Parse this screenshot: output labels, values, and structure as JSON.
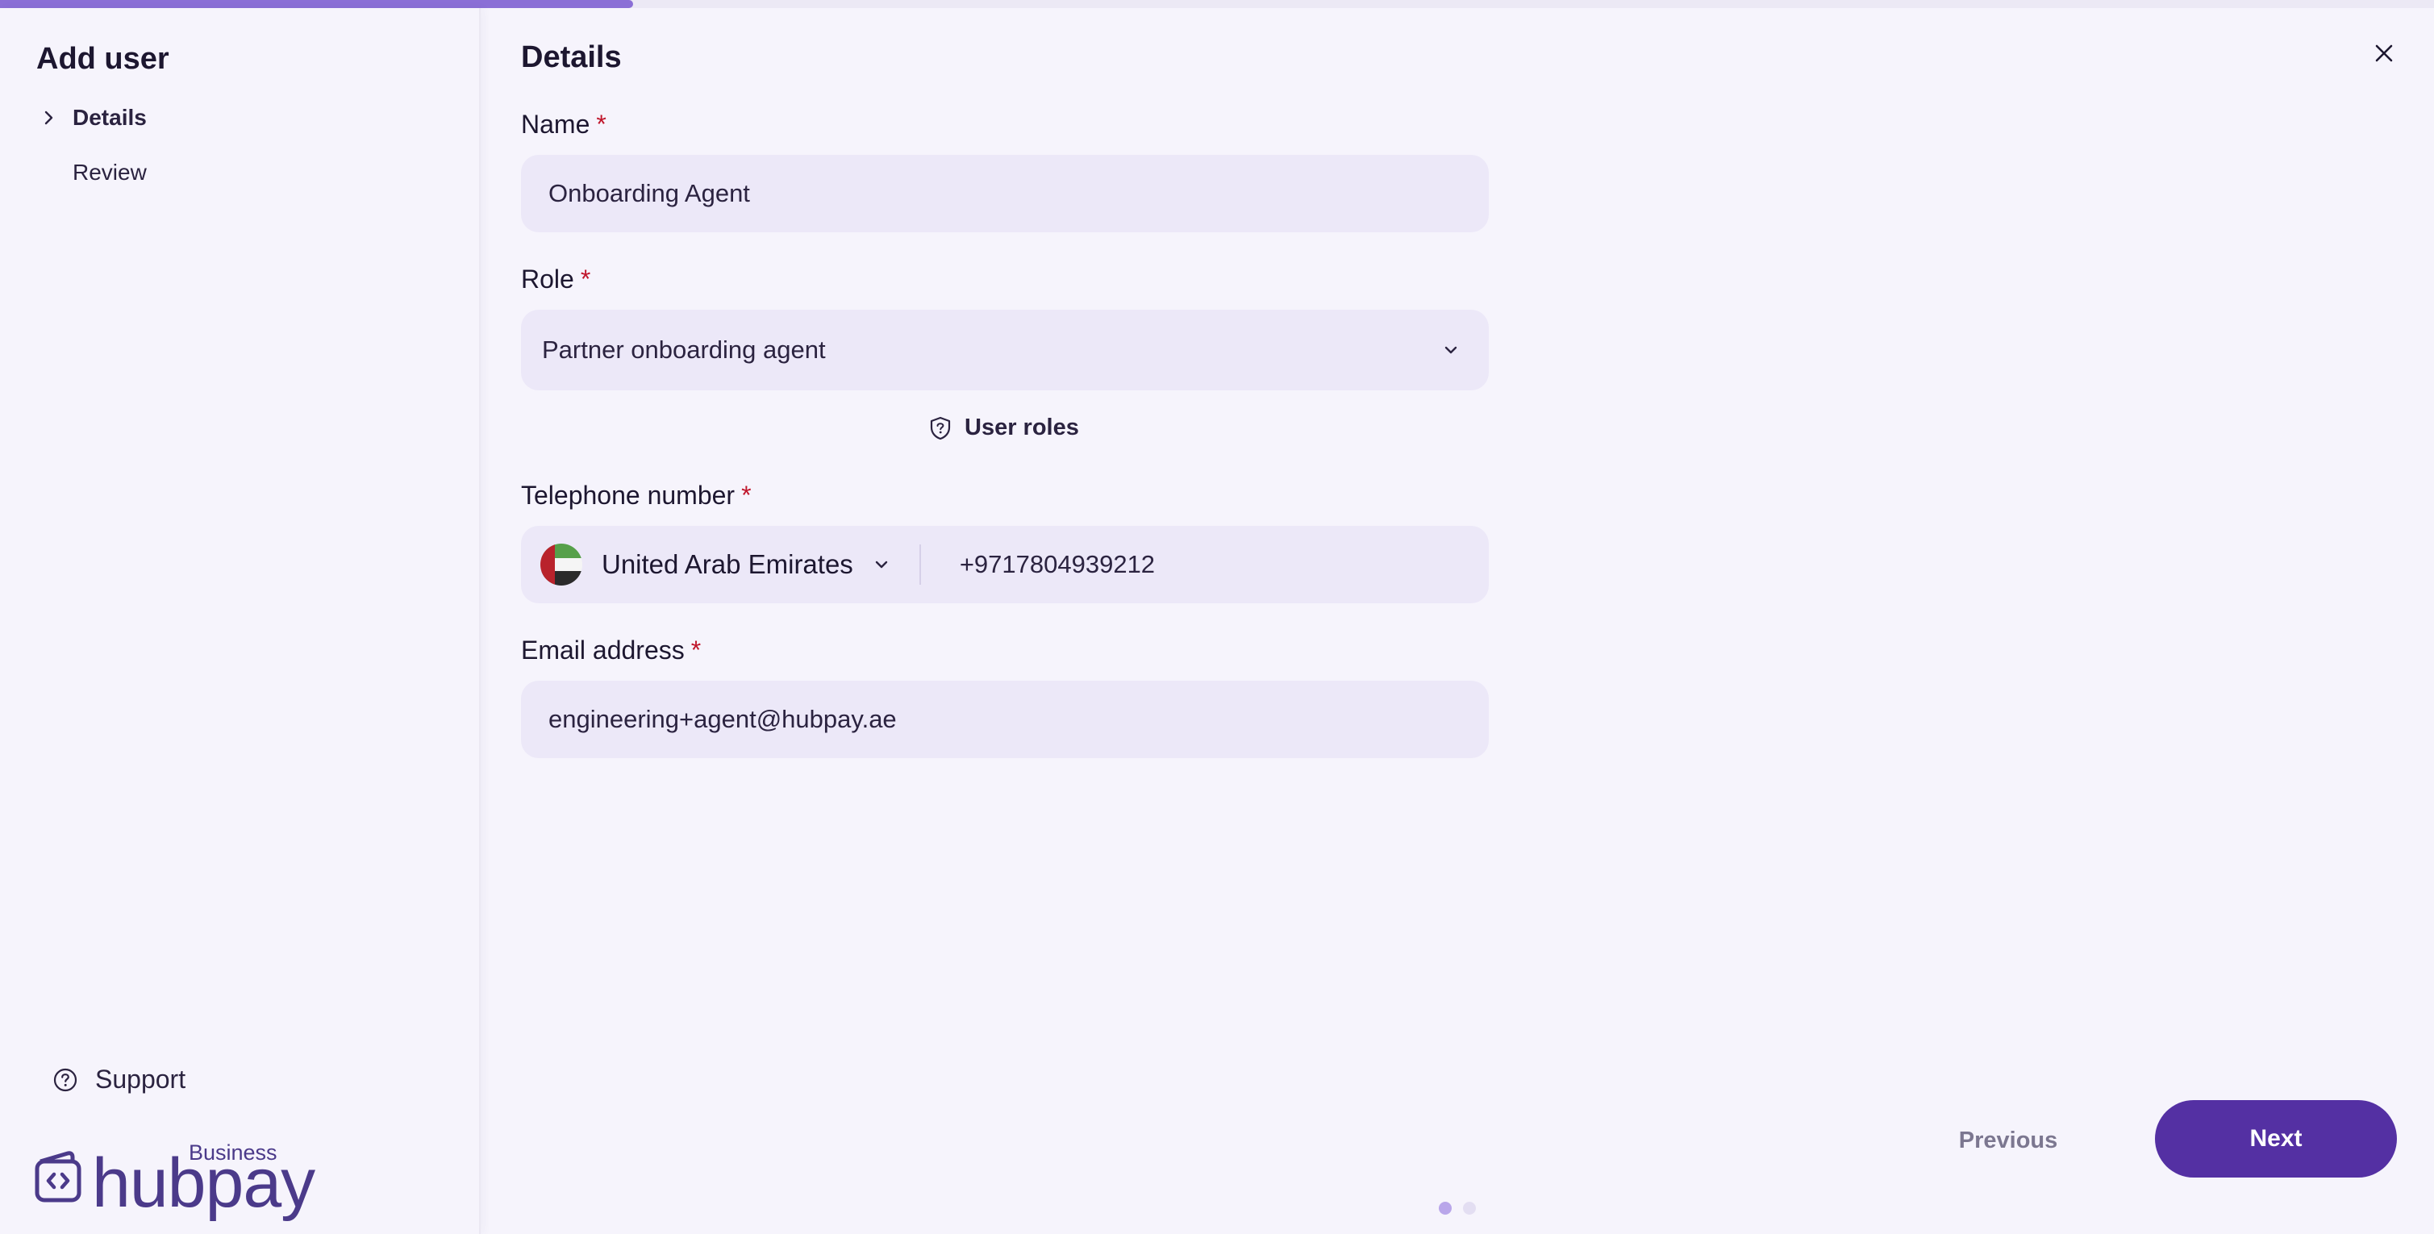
{
  "progress": {
    "fraction": 0.26,
    "color": "#8b6fd6"
  },
  "sidebar": {
    "title": "Add user",
    "steps": [
      {
        "label": "Details",
        "active": true
      },
      {
        "label": "Review",
        "active": false
      }
    ],
    "support_label": "Support",
    "logo": {
      "wordmark": "hubpay",
      "tag": "Business"
    }
  },
  "main": {
    "title": "Details",
    "required_marker": "*",
    "name": {
      "label": "Name",
      "value": "Onboarding Agent"
    },
    "role": {
      "label": "Role",
      "value": "Partner onboarding agent"
    },
    "user_roles_link": "User roles",
    "phone": {
      "label": "Telephone number",
      "country": "United Arab Emirates",
      "value": "+9717804939212"
    },
    "email": {
      "label": "Email address",
      "value": "engineering+agent@hubpay.ae"
    }
  },
  "footer": {
    "previous_label": "Previous",
    "next_label": "Next",
    "page_dots": {
      "total": 2,
      "current": 1
    }
  },
  "colors": {
    "accent": "#5430a3",
    "required": "#c0162b",
    "field_bg": "#ece8f8",
    "page_bg": "#f6f4fc"
  },
  "icons": [
    "chevron-right-icon",
    "help-circle-icon",
    "close-icon",
    "chevron-down-icon",
    "shield-icon",
    "uae-flag-icon"
  ]
}
